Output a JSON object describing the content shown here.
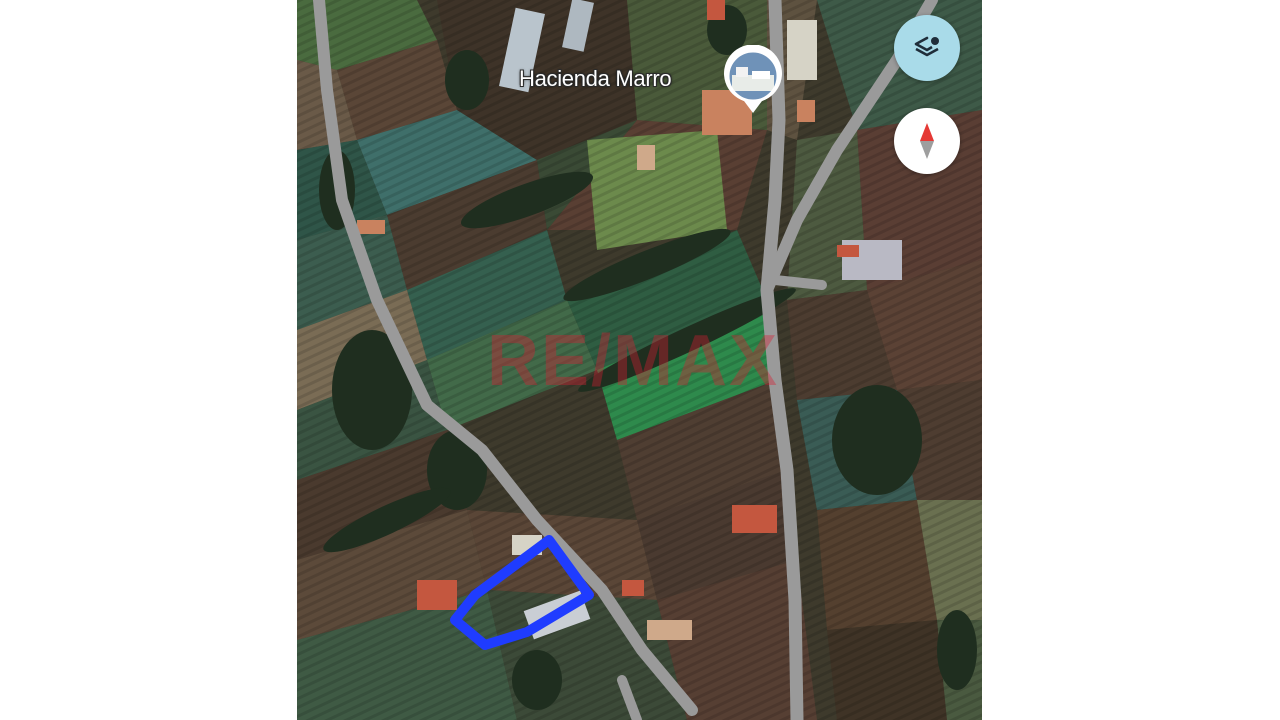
{
  "map": {
    "view": "satellite",
    "place_label": "Hacienda Marro",
    "place_pin_icon": "place-photo-pin-icon",
    "property_outline_color": "#1f3cff",
    "road_color": "#9a9a9a",
    "watermark": {
      "text": "RE/MAX",
      "color": "#d71e32"
    }
  },
  "controls": {
    "layers_icon": "layers-icon",
    "layers_button_color": "#a9dbe9",
    "compass_icon": "compass-icon"
  }
}
